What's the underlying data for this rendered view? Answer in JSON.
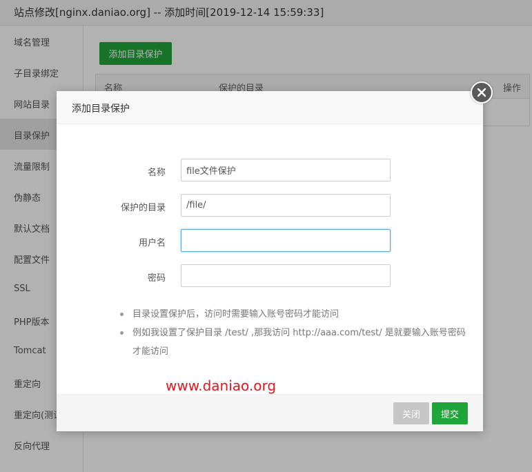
{
  "window": {
    "title": "站点修改[nginx.daniao.org] -- 添加时间[2019-12-14 15:59:33]"
  },
  "sidebar": {
    "items": [
      {
        "label": "域名管理"
      },
      {
        "label": "子目录绑定"
      },
      {
        "label": "网站目录"
      },
      {
        "label": "目录保护"
      },
      {
        "label": "流量限制"
      },
      {
        "label": "伪静态"
      },
      {
        "label": "默认文档"
      },
      {
        "label": "配置文件"
      },
      {
        "label": "SSL"
      },
      {
        "label": "PHP版本"
      },
      {
        "label": "Tomcat"
      },
      {
        "label": "重定向"
      },
      {
        "label": "重定向(测试版)"
      },
      {
        "label": "反向代理"
      }
    ],
    "active_index": 3
  },
  "content": {
    "add_button_label": "添加目录保护",
    "table_headers": [
      "名称",
      "保护的目录",
      "操作"
    ]
  },
  "modal": {
    "title": "添加目录保护",
    "fields": [
      {
        "label": "名称",
        "value": "file文件保护",
        "placeholder": ""
      },
      {
        "label": "保护的目录",
        "value": "/file/",
        "placeholder": ""
      },
      {
        "label": "用户名",
        "value": "",
        "placeholder": ""
      },
      {
        "label": "密码",
        "value": "",
        "placeholder": ""
      }
    ],
    "notes": [
      "目录设置保护后，访问时需要输入账号密码才能访问",
      "例如我设置了保护目录 /test/ ,那我访问 http://aaa.com/test/ 是就要输入账号密码才能访问"
    ],
    "watermark": "www.daniao.org",
    "close_label": "关闭",
    "submit_label": "提交"
  },
  "colors": {
    "accent": "#20a53a",
    "watermark": "#e8141c",
    "focus": "#5aa9e6"
  },
  "icons": {
    "close": "close-icon"
  }
}
